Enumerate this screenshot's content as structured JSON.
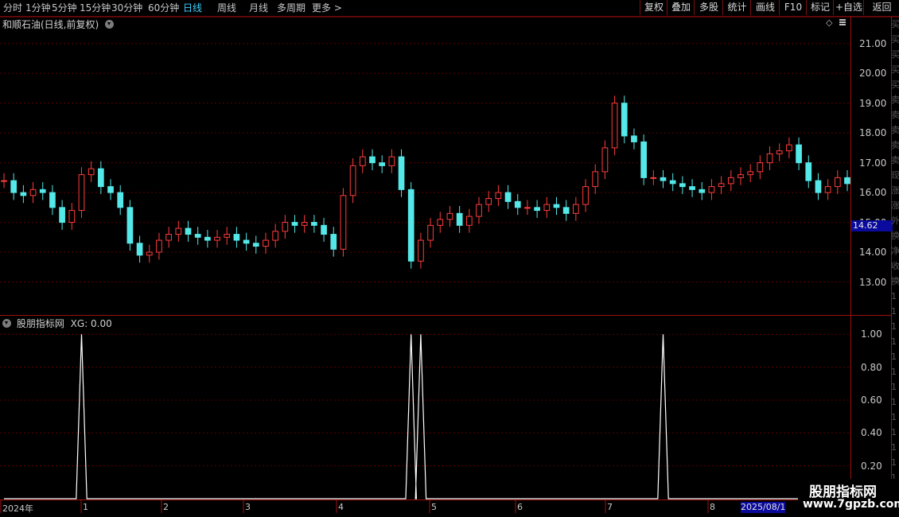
{
  "toolbar": {
    "timeframes": [
      "分时",
      "1分钟",
      "5分钟",
      "15分钟",
      "30分钟",
      "60分钟",
      "日线",
      "周线",
      "月线",
      "多周期",
      "更多 >"
    ],
    "active_timeframe": "日线",
    "right_buttons": [
      "复权",
      "叠加",
      "多股",
      "统计",
      "画线",
      "F10",
      "标记",
      "+自选",
      "返回"
    ]
  },
  "main_panel": {
    "title": "和顺石油(日线,前复权)",
    "price_axis": [
      "21.00",
      "20.00",
      "19.00",
      "18.00",
      "17.00",
      "16.00",
      "15.00",
      "14.00",
      "13.00"
    ],
    "current_price": "14.62"
  },
  "indicator_panel": {
    "title": "股朋指标网",
    "value_label": "XG: 0.00",
    "axis": [
      "1.00",
      "0.80",
      "0.60",
      "0.40",
      "0.20"
    ]
  },
  "time_axis": {
    "labels": [
      "2024年",
      "1",
      "2",
      "3",
      "4",
      "5",
      "6",
      "7",
      "8"
    ],
    "cursor_date": "2025/08/1"
  },
  "watermark": {
    "line1": "股朋指标网",
    "line2": "www.7gpzb.com"
  },
  "colors": {
    "up": "#ff3c3c",
    "down": "#54e8e8",
    "grid": "#5a0000",
    "border": "#a01010",
    "signal": "#ffffff",
    "active_tab": "#3fd0ff"
  },
  "chart_data": {
    "type": "candlestick",
    "title": "和顺石油(日线,前复权)",
    "ylim": [
      12.0,
      21.5
    ],
    "prices": [
      16.4,
      16.0,
      15.9,
      16.1,
      16.0,
      15.5,
      15.0,
      15.4,
      16.6,
      16.8,
      16.2,
      16.0,
      15.5,
      14.3,
      13.9,
      14.0,
      14.4,
      14.6,
      14.8,
      14.6,
      14.5,
      14.4,
      14.5,
      14.6,
      14.4,
      14.3,
      14.2,
      14.4,
      14.7,
      15.0,
      14.9,
      15.0,
      14.9,
      14.6,
      14.1,
      15.9,
      16.9,
      17.2,
      17.0,
      16.9,
      17.2,
      16.1,
      13.7,
      14.4,
      14.9,
      15.1,
      15.3,
      14.9,
      15.2,
      15.6,
      15.8,
      16.0,
      15.7,
      15.5,
      15.5,
      15.4,
      15.6,
      15.5,
      15.3,
      15.6,
      16.2,
      16.7,
      17.5,
      19.0,
      17.9,
      17.7,
      16.5,
      16.5,
      16.4,
      16.3,
      16.2,
      16.1,
      16.0,
      16.2,
      16.3,
      16.5,
      16.6,
      16.7,
      17.0,
      17.3,
      17.4,
      17.6,
      17.0,
      16.4,
      16.0,
      16.2,
      16.5,
      16.3
    ],
    "signal": {
      "name": "XG",
      "values": [
        0,
        0,
        0,
        0,
        0,
        0,
        0,
        0,
        1,
        0,
        0,
        0,
        0,
        0,
        0,
        0,
        0,
        0,
        0,
        0,
        0,
        0,
        0,
        0,
        0,
        0,
        0,
        0,
        0,
        0,
        0,
        0,
        0,
        0,
        0,
        0,
        0,
        0,
        0,
        0,
        0,
        0,
        1,
        1,
        0,
        0,
        0,
        0,
        0,
        0,
        0,
        0,
        0,
        0,
        0,
        0,
        0,
        0,
        0,
        0,
        0,
        0,
        0,
        0,
        0,
        0,
        0,
        0,
        1,
        0,
        0,
        0,
        0,
        0,
        0,
        0,
        0,
        0,
        0,
        0,
        0,
        0,
        0,
        0,
        0,
        0,
        0,
        0,
        0
      ],
      "ylim": [
        0,
        1.05
      ]
    }
  }
}
